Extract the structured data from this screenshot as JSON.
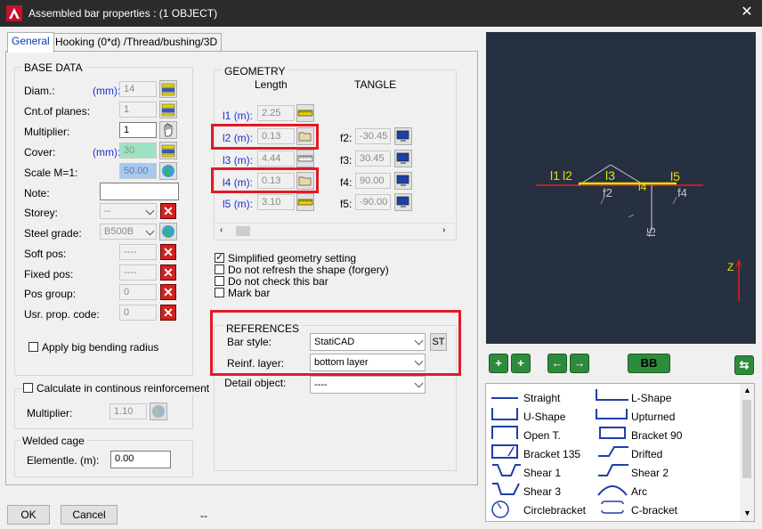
{
  "window": {
    "title": "Assembled bar properties :  (1 OBJECT)",
    "close_glyph": "✕"
  },
  "tabs": [
    {
      "label": "General"
    },
    {
      "label": "Hooking (0*d) /Thread/bushing/3D"
    }
  ],
  "base_data": {
    "title": "BASE DATA",
    "diam_label": "Diam.:",
    "diam_unit": "(mm):",
    "diam_value": "14",
    "planes_label": "Cnt.of planes:",
    "planes_value": "1",
    "multiplier_label": "Multiplier:",
    "multiplier_value": "1",
    "cover_label": "Cover:",
    "cover_unit": "(mm):",
    "cover_value": "30",
    "scale_label": "Scale M=1:",
    "scale_value": "50.00",
    "note_label": "Note:",
    "note_value": "",
    "storey_label": "Storey:",
    "storey_value": "--",
    "steel_label": "Steel grade:",
    "steel_value": "B500B",
    "softpos_label": "Soft pos:",
    "softpos_value": "----",
    "fixedpos_label": "Fixed pos:",
    "fixedpos_value": "----",
    "posgroup_label": "Pos group:",
    "posgroup_value": "0",
    "usrprop_label": "Usr. prop. code:",
    "usrprop_value": "0",
    "big_bending_label": "Apply big bending radius"
  },
  "continuous": {
    "label": "Calculate in continous reinforcement",
    "multiplier_label": "Multiplier:",
    "multiplier_value": "1.10"
  },
  "welded": {
    "title": "Welded cage",
    "elem_label": "Elementle. (m):",
    "elem_value": "0.00"
  },
  "geometry": {
    "title": "GEOMETRY",
    "col_length": "Length",
    "col_tangle": "TANGLE",
    "rows": [
      {
        "label": "l1",
        "unit": "(m):",
        "value": "2.25"
      },
      {
        "label": "l2",
        "unit": "(m):",
        "value": "0.13"
      },
      {
        "label": "l3",
        "unit": "(m):",
        "value": "4.44"
      },
      {
        "label": "l4",
        "unit": "(m):",
        "value": "0.13"
      },
      {
        "label": "l5",
        "unit": "(m):",
        "value": "3.10"
      }
    ],
    "angles": [
      {
        "label": "f2:",
        "value": "-30.45"
      },
      {
        "label": "f3:",
        "value": "30.45"
      },
      {
        "label": "f4:",
        "value": "90.00"
      },
      {
        "label": "f5:",
        "value": "-90.00"
      }
    ]
  },
  "options": [
    {
      "label": "Simplified geometry setting",
      "checked": true
    },
    {
      "label": "Do not refresh the shape (forgery)",
      "checked": false
    },
    {
      "label": "Do not check this bar",
      "checked": false
    },
    {
      "label": "Mark bar",
      "checked": false
    }
  ],
  "references": {
    "title": "REFERENCES",
    "barstyle_label": "Bar style:",
    "barstyle_value": "StatiCAD",
    "st_button": "ST",
    "layer_label": "Reinf. layer:",
    "layer_value": "bottom layer",
    "detail_label": "Detail object:",
    "detail_value": "----"
  },
  "preview": {
    "labels": [
      "l1",
      "l2",
      "l3",
      "l4",
      "l5",
      "f2",
      "f4",
      "f5",
      "Z"
    ]
  },
  "nav": {
    "bb_label": "BB"
  },
  "shapes": [
    {
      "label": "Straight"
    },
    {
      "label": "L-Shape"
    },
    {
      "label": "U-Shape"
    },
    {
      "label": "Upturned"
    },
    {
      "label": "Open T."
    },
    {
      "label": "Bracket 90"
    },
    {
      "label": "Bracket 135"
    },
    {
      "label": "Drifted"
    },
    {
      "label": "Shear 1"
    },
    {
      "label": "Shear 2"
    },
    {
      "label": "Shear 3"
    },
    {
      "label": "Arc"
    },
    {
      "label": "Circlebracket"
    },
    {
      "label": "C-bracket"
    }
  ],
  "footer": {
    "ok": "OK",
    "cancel": "Cancel",
    "status": "--"
  },
  "colors": {
    "accent_red": "#e01b24",
    "preview_bg": "#263040",
    "bar_red": "#e02020",
    "bar_yellow": "#e8e000"
  }
}
